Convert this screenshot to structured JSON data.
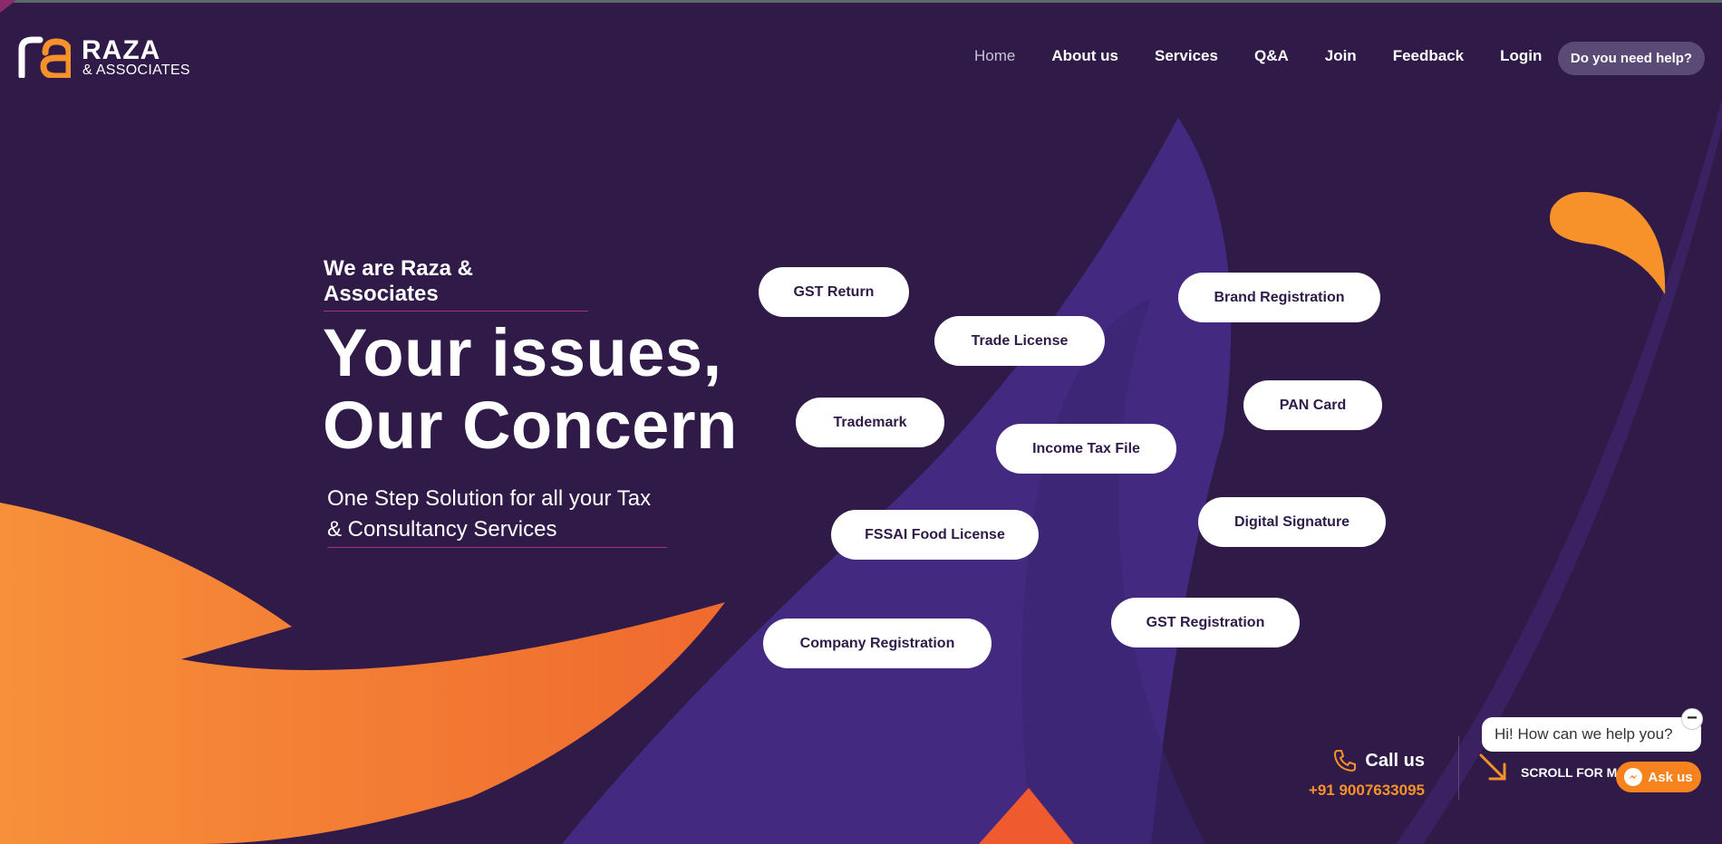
{
  "brand": {
    "name": "RAZA",
    "sub": "& ASSOCIATES",
    "accent": "#f7922b",
    "background": "#2f1a48"
  },
  "nav": {
    "items": [
      "Home",
      "About us",
      "Services",
      "Q&A",
      "Join",
      "Feedback",
      "Login"
    ],
    "help_button": "Do you need help?"
  },
  "hero": {
    "tagline": "We are Raza & Associates",
    "headline_line1": "Your issues,",
    "headline_line2": "Our Concern",
    "subline": "One Step Solution for all your Tax & Consultancy Services"
  },
  "services": [
    "GST Return",
    "Brand Registration",
    "Trade License",
    "PAN Card",
    "Trademark",
    "Income Tax File",
    "Digital Signature",
    "FSSAI Food License",
    "GST Registration",
    "Company Registration"
  ],
  "contact": {
    "label": "Call us",
    "phone": "+91 9007633095"
  },
  "scroll": {
    "label": "SCROLL FOR MO"
  },
  "chat": {
    "greeting": "Hi! How can we help you?",
    "close": "−",
    "button": "Ask us"
  },
  "icons": [
    "logo-mark-icon",
    "phone-icon",
    "arrow-down-right-icon",
    "messenger-icon",
    "minus-icon"
  ]
}
